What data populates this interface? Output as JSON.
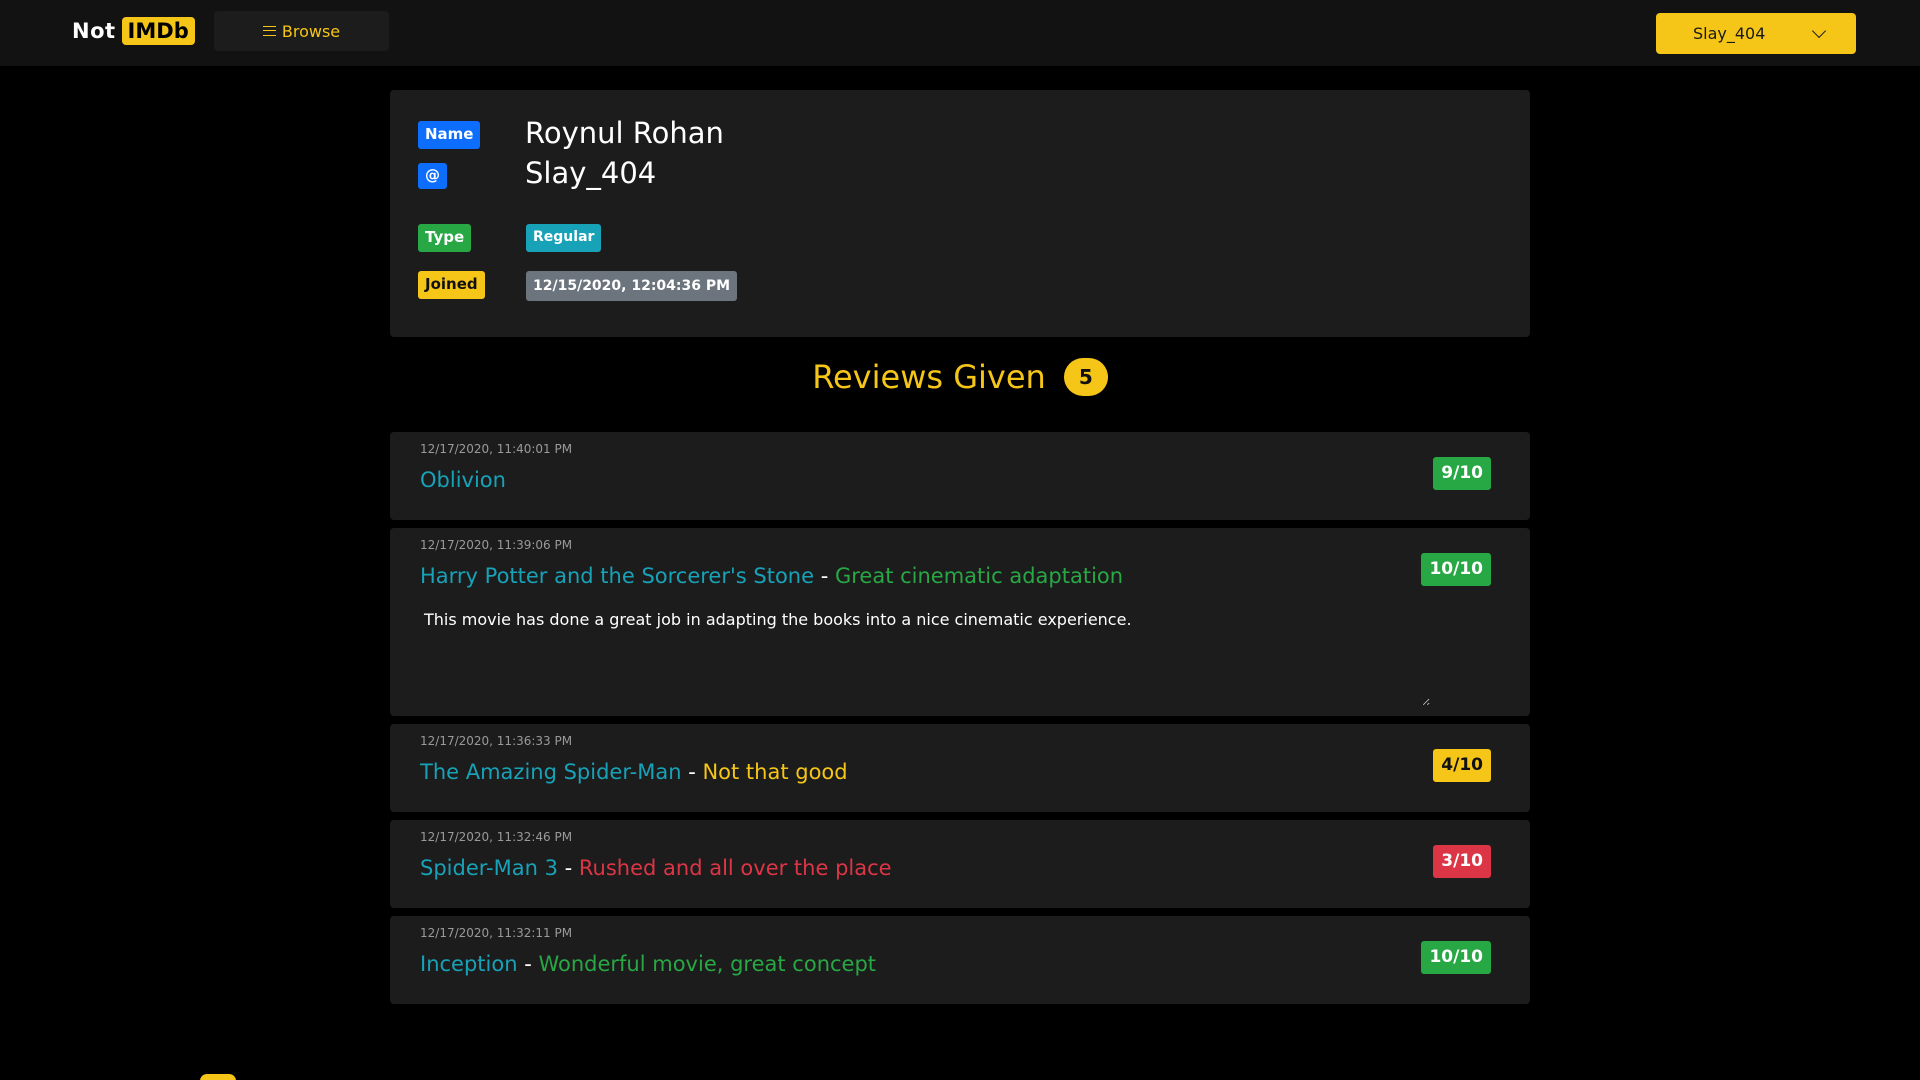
{
  "nav": {
    "logo_not": "Not",
    "logo_imdb": "IMDb",
    "browse_label": "Browse",
    "user_label": "Slay_404"
  },
  "profile": {
    "name_badge": "Name",
    "at_badge": "@",
    "name": "Roynul Rohan",
    "username": "Slay_404",
    "type_badge": "Type",
    "type_value": "Regular",
    "joined_badge": "Joined",
    "joined_value": "12/15/2020, 12:04:36 PM"
  },
  "reviews_header": {
    "title": "Reviews Given",
    "count": "5"
  },
  "reviews": [
    {
      "time": "12/17/2020, 11:40:01 PM",
      "movie": "Oblivion",
      "sep": "",
      "headline": "",
      "score": "9/10",
      "color": "#28a745"
    },
    {
      "time": "12/17/2020, 11:39:06 PM",
      "movie": "Harry Potter and the Sorcerer's Stone",
      "sep": " - ",
      "headline": "Great cinematic adaptation",
      "score": "10/10",
      "color": "#28a745",
      "text": "This movie has done a great job in adapting the books into a nice cinematic experience."
    },
    {
      "time": "12/17/2020, 11:36:33 PM",
      "movie": "The Amazing Spider-Man",
      "sep": " - ",
      "headline": "Not that good",
      "score": "4/10",
      "color": "#f5c518"
    },
    {
      "time": "12/17/2020, 11:32:46 PM",
      "movie": "Spider-Man 3",
      "sep": " - ",
      "headline": "Rushed and all over the place",
      "score": "3/10",
      "color": "#dc3545"
    },
    {
      "time": "12/17/2020, 11:32:11 PM",
      "movie": "Inception",
      "sep": " - ",
      "headline": "Wonderful movie, great concept",
      "score": "10/10",
      "color": "#28a745"
    }
  ]
}
